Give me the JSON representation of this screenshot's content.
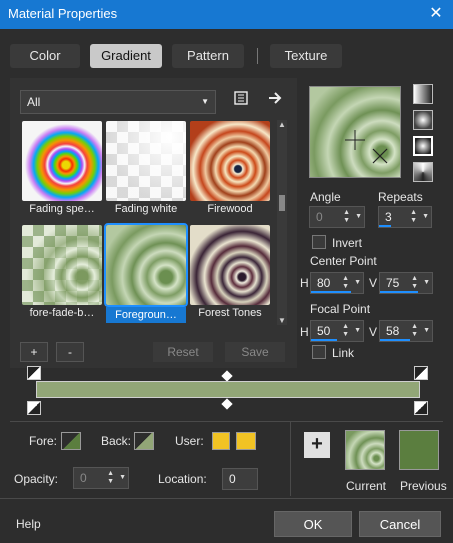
{
  "window": {
    "title": "Material Properties",
    "close_glyph": "✕"
  },
  "tabs": [
    {
      "label": "Color"
    },
    {
      "label": "Gradient"
    },
    {
      "label": "Pattern"
    },
    {
      "label": "Texture"
    }
  ],
  "library": {
    "category_value": "All",
    "items": [
      {
        "label": "Fading spe…"
      },
      {
        "label": "Fading white"
      },
      {
        "label": "Firewood"
      },
      {
        "label": "fore-fade-b…"
      },
      {
        "label": "Foregroun…"
      },
      {
        "label": "Forest Tones"
      }
    ],
    "add_label": "+",
    "remove_label": "-",
    "reset_label": "Reset",
    "save_label": "Save"
  },
  "settings": {
    "angle_label": "Angle",
    "angle_value": "0",
    "repeats_label": "Repeats",
    "repeats_value": "3",
    "invert_label": "Invert",
    "center_point_label": "Center Point",
    "center_h_label": "H",
    "center_h_value": "80",
    "center_v_label": "V",
    "center_v_value": "75",
    "focal_point_label": "Focal Point",
    "focal_h_label": "H",
    "focal_h_value": "50",
    "focal_v_label": "V",
    "focal_v_value": "58",
    "link_label": "Link"
  },
  "stops": {
    "fore_label": "Fore:",
    "back_label": "Back:",
    "user_label": "User:",
    "opacity_label": "Opacity:",
    "opacity_value": "0",
    "location_label": "Location:",
    "location_value": "0"
  },
  "compare": {
    "add_label": "+",
    "current_label": "Current",
    "previous_label": "Previous"
  },
  "footer": {
    "help_label": "Help",
    "ok_label": "OK",
    "cancel_label": "Cancel"
  },
  "colors": {
    "accent": "#1778d2",
    "gradient_green": "#92a677",
    "previous_green": "#5b7e3f",
    "user_yellow": "#f1c324"
  }
}
